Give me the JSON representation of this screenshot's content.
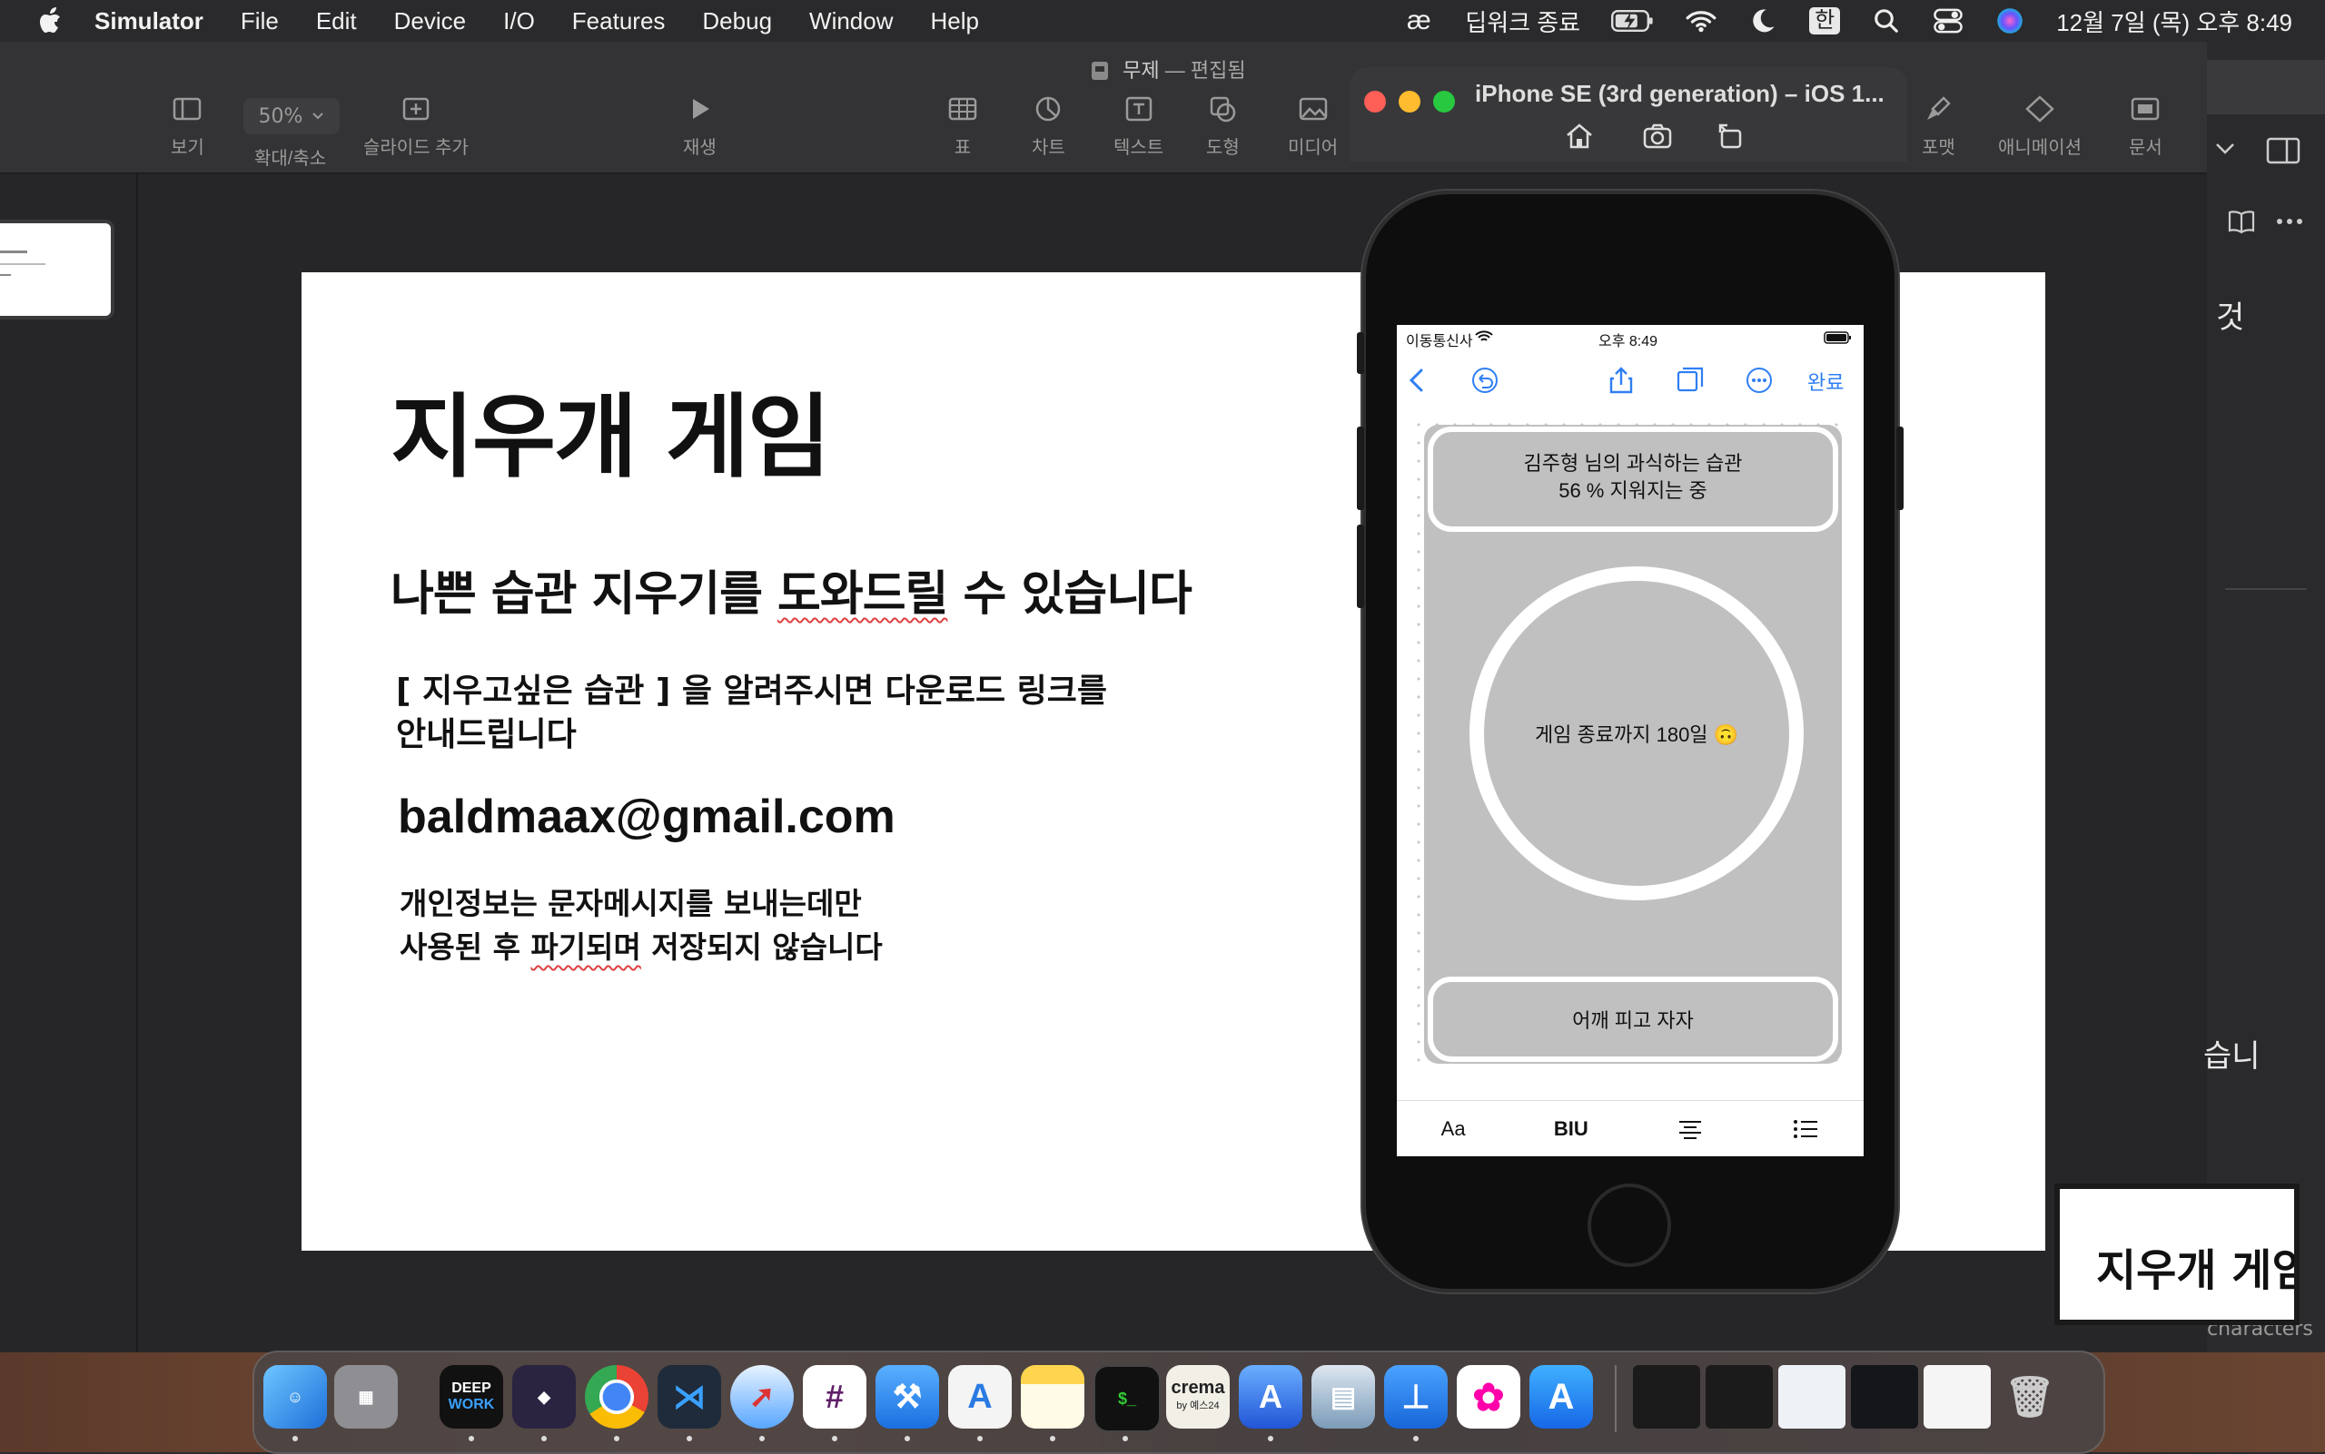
{
  "menubar": {
    "app_name": "Simulator",
    "items": [
      "File",
      "Edit",
      "Device",
      "I/O",
      "Features",
      "Debug",
      "Window",
      "Help"
    ],
    "deepl_label": "딥워크 종료",
    "input_source": "한",
    "clock": "12월 7일 (목) 오후 8:49"
  },
  "keynote": {
    "doc_title": "무제",
    "doc_state": "편집됨",
    "toolbar": {
      "view": "보기",
      "zoom_value": "50%",
      "zoom_label": "확대/축소",
      "add_slide": "슬라이드 추가",
      "play": "재생",
      "table": "표",
      "chart": "차트",
      "text": "텍스트",
      "shape": "도형",
      "media": "미디어",
      "format": "포맷",
      "animate": "애니메이션",
      "document": "문서"
    },
    "slide": {
      "title": "지우개 게임",
      "subtitle_plain": "나쁜 습관 지우기를 ",
      "subtitle_marked": "도와드릴",
      "subtitle_rest": " 수 있습니다",
      "body_line1": "[  지우고싶은 습관  ] 을 알려주시면 다운로드 링크를",
      "body_line2": "안내드립니다",
      "email": "baldmaax@gmail.com",
      "privacy_line1": "개인정보는 문자메시지를 보내는데만",
      "privacy_line2_a": "사용된 후 ",
      "privacy_line2_marked": "파기되며",
      "privacy_line2_b": " 저장되지 않습니다"
    }
  },
  "right_window": {
    "text_top": "것",
    "text_mid": "습니",
    "text_bottom": "characters",
    "mini_card_title": "지우개 게임"
  },
  "simulator": {
    "title": "iPhone SE (3rd generation) – iOS 1...",
    "status": {
      "carrier": "이동통신사",
      "time": "오후 8:49"
    },
    "done": "완료",
    "habit_line1": "김주형 님의 과식하는 습관",
    "habit_line2": "56 % 지워지는 중",
    "countdown": "게임 종료까지 180일 🙃",
    "bottom_note": "어깨 피고 자자",
    "format_bar": [
      "Aa",
      "BIU"
    ]
  },
  "dock": {
    "apps": [
      "Finder",
      "Launchpad",
      "DeepWork",
      "Obsidian",
      "Chrome",
      "VS Code",
      "Safari",
      "Slack",
      "Xcode",
      "Instruments",
      "Notes",
      "Terminal",
      "crema",
      "Simulator",
      "Preview",
      "Keynote",
      "Photos",
      "App Store"
    ],
    "deepwork_line1": "DEEP",
    "deepwork_line2": "WORK",
    "crema_line1": "crema",
    "crema_line2": "by 예스24"
  },
  "colors": {
    "accent": "#2f7ff3",
    "note_gray": "#c0c0c0",
    "traffic_red": "#fe5f57",
    "traffic_yellow": "#febc2e",
    "traffic_green": "#28c840"
  }
}
